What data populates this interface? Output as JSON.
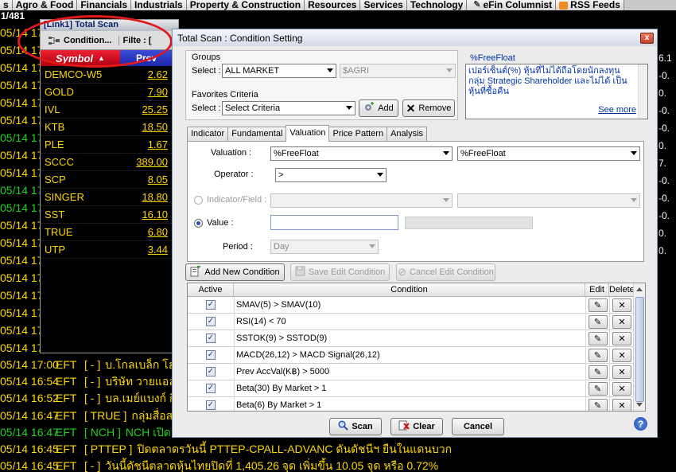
{
  "top_tabs": [
    {
      "label": "s"
    },
    {
      "label": "Agro & Food"
    },
    {
      "label": "Financials"
    },
    {
      "label": "Industrials"
    },
    {
      "label": "Property & Construction"
    },
    {
      "label": "Resources"
    },
    {
      "label": "Services"
    },
    {
      "label": "Technology"
    },
    {
      "label": "eFin Columnist"
    },
    {
      "label": "RSS Feeds"
    }
  ],
  "counter": "1/481",
  "bg_rows": [
    {
      "date": "05/14 17"
    },
    {
      "date": "05/14 17"
    },
    {
      "date": "05/14 17"
    },
    {
      "date": "05/14 17"
    },
    {
      "date": "05/14 17"
    },
    {
      "date": "05/14 17"
    },
    {
      "date": "05/14 17"
    },
    {
      "date": "05/14 17"
    },
    {
      "date": "05/14 17"
    },
    {
      "date": "05/14 17"
    },
    {
      "date": "05/14 17"
    },
    {
      "date": "05/14 17"
    },
    {
      "date": "05/14 17"
    },
    {
      "date": "05/14 17"
    },
    {
      "date": "05/14 17"
    },
    {
      "date": "05/14 17"
    },
    {
      "date": "05/14 17"
    },
    {
      "date": "05/14 17"
    },
    {
      "date": "05/14 17"
    }
  ],
  "news": [
    {
      "date": "05/14 17:00",
      "src": "EFT",
      "tag": "[ - ]",
      "text": "บ.โกลเบล็ก โฮ"
    },
    {
      "date": "05/14 16:54",
      "src": "EFT",
      "tag": "[ - ]",
      "text": "บริษัท วายแอล"
    },
    {
      "date": "05/14 16:52",
      "src": "EFT",
      "tag": "[ - ]",
      "text": "บล.เมย์แบงก์ กิ"
    },
    {
      "date": "05/14 16:47",
      "src": "EFT",
      "tag": "[ TRUE ]",
      "text": "กลุ่มสื่อส"
    },
    {
      "date": "05/14 16:47",
      "src": "EFT",
      "tag": "[ NCH ]",
      "text": "NCH เปิด"
    },
    {
      "date": "05/14 16:45",
      "src": "EFT",
      "tag": "[ PTTEP ]",
      "text": "ปิดตลาดรวันนี้ PTTEP-CPALL-ADVANC ดันดัชนีฯ ยืนในแดนบวก"
    },
    {
      "date": "05/14 16:45",
      "src": "EFT",
      "tag": "[ - ]",
      "text": "วันนี้ดัชนีตลาดหุ้นไทยปิดที่ 1,405.26 จุด เพิ่มขึ้น 10.05 จุด หรือ 0.72%"
    }
  ],
  "scan_panel": {
    "title": "[Link1] Total Scan",
    "condition_label": "Condition...",
    "filter_label": "Filte : [",
    "col_symbol": "Symbol",
    "col_prev": "Prev",
    "rows": [
      {
        "symbol": "DEMCO-W5",
        "prev": "2.62"
      },
      {
        "symbol": "GOLD",
        "prev": "7.90"
      },
      {
        "symbol": "IVL",
        "prev": "25.25"
      },
      {
        "symbol": "KTB",
        "prev": "18.50"
      },
      {
        "symbol": "PLE",
        "prev": "1.67"
      },
      {
        "symbol": "SCCC",
        "prev": "389.00"
      },
      {
        "symbol": "SCP",
        "prev": "8.05"
      },
      {
        "symbol": "SINGER",
        "prev": "18.80"
      },
      {
        "symbol": "SST",
        "prev": "16.10"
      },
      {
        "symbol": "TRUE",
        "prev": "6.80"
      },
      {
        "symbol": "UTP",
        "prev": "3.44"
      }
    ]
  },
  "right_values": [
    "6.1",
    "-0.",
    "0.",
    "-0.",
    "-0.",
    "0.",
    "7.",
    "-0.",
    "-0.",
    "-0.",
    "0.",
    "0."
  ],
  "dialog": {
    "title": "Total Scan : Condition Setting",
    "close": "x",
    "groups_label": "Groups",
    "select_label": "Select :",
    "groups_value": "ALL MARKET",
    "groups_sub_value": "$AGRI",
    "favorites_label": "Favorites Criteria",
    "favorites_value": "Select Criteria",
    "add_label": "Add",
    "remove_label": "Remove",
    "info_title": "%FreeFloat",
    "info_text": "เปอร์เซ็นต์(%) หุ้นที่ไม่ได้ถือโดยนักลงทุนกลุ่ม Strategic Shareholder และไม่ได้ เป็นหุ้นที่ซื้อคืน",
    "see_more": "See more",
    "tabs": [
      "Indicator",
      "Fundamental",
      "Valuation",
      "Price Pattern",
      "Analysis"
    ],
    "active_tab": "Valuation",
    "valuation_label": "Valuation :",
    "valuation_value": "%FreeFloat",
    "valuation_value2": "%FreeFloat",
    "operator_label": "Operator :",
    "operator_value": ">",
    "indicator_label": "Indicator/Field :",
    "value_label": "Value :",
    "value_input": "",
    "period_label": "Period :",
    "period_value": "Day",
    "add_condition": "Add New Condition",
    "save_condition": "Save Edit Condition",
    "cancel_condition": "Cancel Edit Condition",
    "grid_headers": {
      "active": "Active",
      "condition": "Condition",
      "edit": "Edit",
      "delete": "Delete"
    },
    "conditions": [
      {
        "text": "SMAV(5) > SMAV(10)"
      },
      {
        "text": "RSI(14) < 70"
      },
      {
        "text": "SSTOK(9) > SSTOD(9)"
      },
      {
        "text": "MACD(26,12) > MACD Signal(26,12)"
      },
      {
        "text": "Prev AccVal(K฿) > 5000"
      },
      {
        "text": "Beta(30) By Market > 1"
      },
      {
        "text": "Beta(6) By Market > 1"
      }
    ],
    "scan": "Scan",
    "clear": "Clear",
    "cancel": "Cancel",
    "help": "?"
  },
  "colors": {
    "ticker_text": "#ffd700",
    "ticker_green": "#1fd31f",
    "highlight_circle": "#e01a1a"
  }
}
